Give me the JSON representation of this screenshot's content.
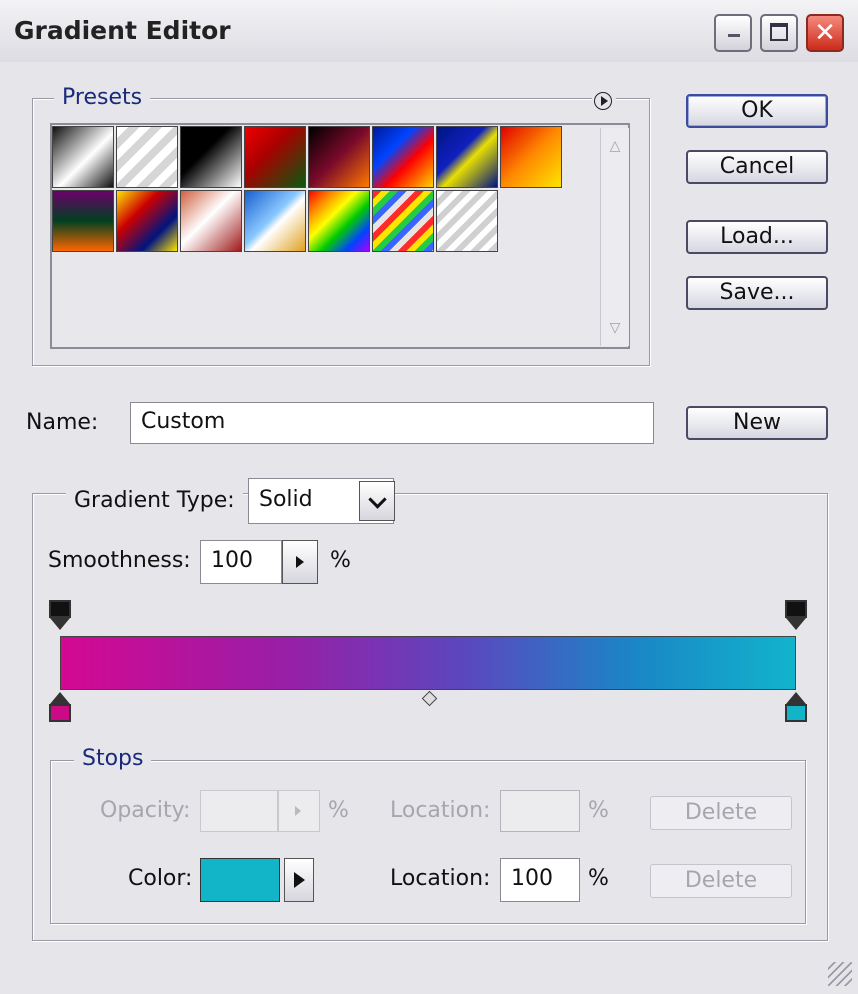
{
  "window": {
    "title": "Gradient Editor"
  },
  "presets": {
    "legend": "Presets",
    "swatches": [
      "linear-gradient(135deg,#111 0%,#fff 55%,#111 100%)",
      "repeating-linear-gradient(135deg,#fff 0 8px,#d6d6d6 8px 16px)",
      "linear-gradient(135deg,#000 40%,#fff 100%)",
      "linear-gradient(135deg,#e00 0%,#a00 40%,#0a5a10 100%)",
      "linear-gradient(135deg,#000 0%,#7a0a2a 50%,#ff7a00 100%)",
      "linear-gradient(135deg,#001a9a 0%,#0044ff 35%,#ff0000 60%,#ffd400 100%)",
      "linear-gradient(135deg,#001480 0%,#1020c0 40%,#e8e000 55%,#001480 100%)",
      "linear-gradient(135deg,#e00000 0%,#ff8a00 50%,#ffe400 100%)",
      "linear-gradient(180deg,#6a006a 0%,#004020 50%,#ff6600 100%)",
      "linear-gradient(135deg,#ffe400 0%,#c00 35%,#001480 70%,#ffe400 100%)",
      "linear-gradient(135deg,#d06040 0%,#fff 45%,#a01a1a 100%)",
      "linear-gradient(135deg,#1a60d0 0%,#8ac8ff 45%,#ffffff 55%,#e0a020 100%)",
      "linear-gradient(135deg,#ff0000 0%,#ff8800 20%,#ffff00 40%,#00cc00 60%,#0044ff 80%,#aa00ff 100%)",
      "repeating-linear-gradient(135deg,#ff2a2a 0 6px,#ffe400 6px 12px,#22cc44 12px 18px,#3a66ff 18px 24px,#e5e5e5 24px 30px)",
      "repeating-linear-gradient(135deg,#ffffff 0 6px,#d0d0d0 6px 12px)"
    ],
    "menu_icon": "play-circle-icon",
    "scroll_up_icon": "scroll-up-icon",
    "scroll_down_icon": "scroll-down-icon"
  },
  "buttons": {
    "ok": "OK",
    "cancel": "Cancel",
    "load": "Load...",
    "save": "Save...",
    "new": "New"
  },
  "name": {
    "label": "Name:",
    "value": "Custom"
  },
  "gradient_type": {
    "label": "Gradient Type:",
    "value": "Solid"
  },
  "smoothness": {
    "label": "Smoothness:",
    "value": "100",
    "unit": "%"
  },
  "gradient": {
    "opacity_stops": [
      {
        "position": 0,
        "color": "#111111"
      },
      {
        "position": 100,
        "color": "#111111"
      }
    ],
    "color_stops": [
      {
        "position": 0,
        "color": "#cc0a86"
      },
      {
        "position": 100,
        "color": "#12b4c8"
      }
    ],
    "midpoint": 50
  },
  "stops": {
    "legend": "Stops",
    "opacity_label": "Opacity:",
    "opacity_value": "",
    "opacity_unit": "%",
    "location_label_1": "Location:",
    "location_value_1": "",
    "location_unit_1": "%",
    "delete_1": "Delete",
    "color_label": "Color:",
    "color_value": "#12b4c8",
    "location_label_2": "Location:",
    "location_value_2": "100",
    "location_unit_2": "%",
    "delete_2": "Delete"
  },
  "icons": {
    "minimize": "minimize-icon",
    "maximize": "maximize-icon",
    "close": "close-icon",
    "dropdown": "chevron-down-icon",
    "slider_popup": "triangle-right-icon"
  }
}
